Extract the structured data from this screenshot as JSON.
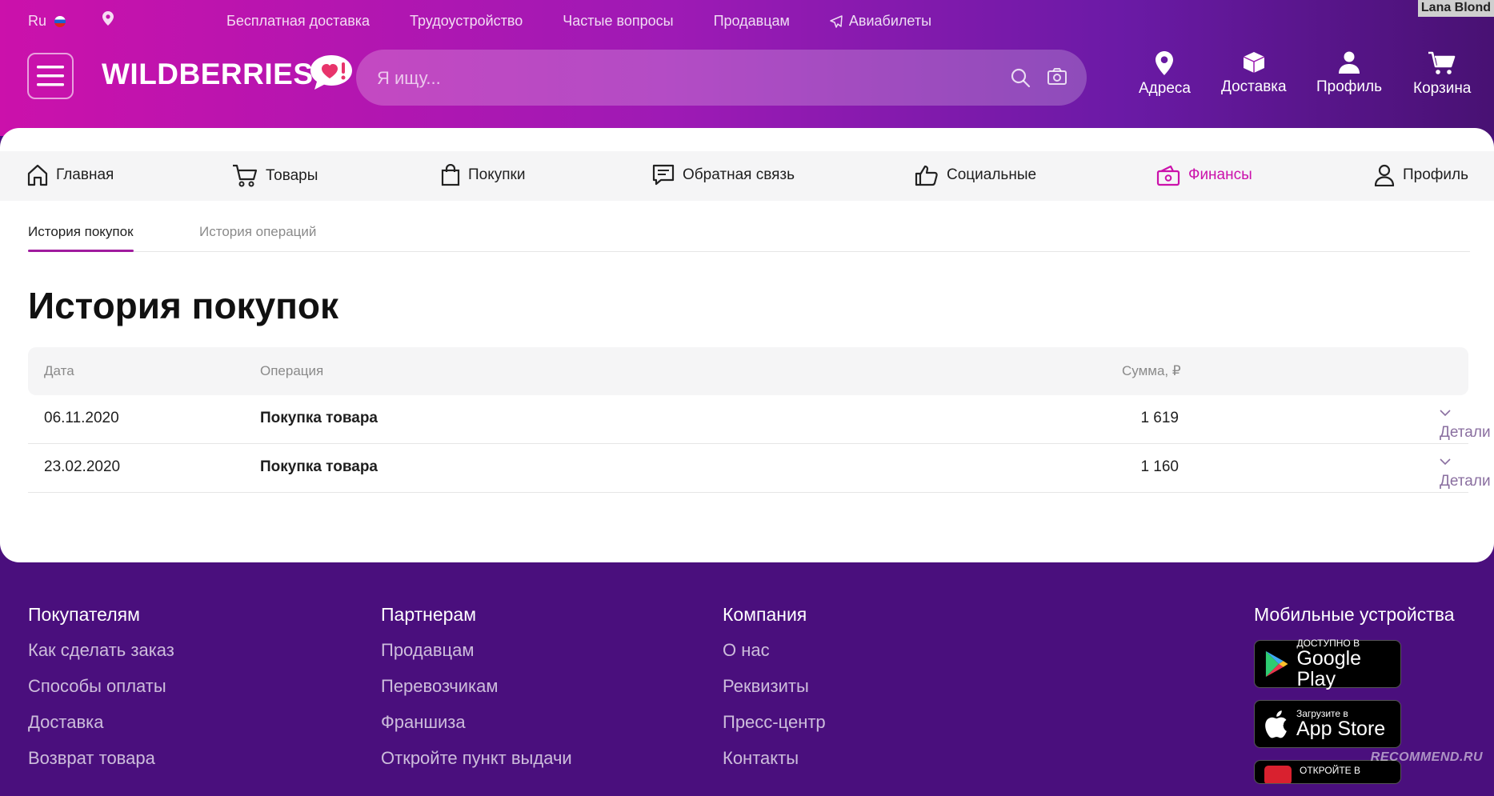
{
  "topbar": {
    "lang": "Ru",
    "links": [
      "Бесплатная доставка",
      "Трудоустройство",
      "Частые вопросы",
      "Продавцам",
      "Авиабилеты"
    ],
    "username": "Lana Blond"
  },
  "logo": {
    "text": "WILDBERRIES"
  },
  "search": {
    "placeholder": "Я ищу..."
  },
  "header_nav": [
    "Адреса",
    "Доставка",
    "Профиль",
    "Корзина"
  ],
  "main_nav": {
    "items": [
      "Главная",
      "Товары",
      "Покупки",
      "Обратная связь",
      "Социальные",
      "Финансы",
      "Профиль"
    ],
    "active": "Финансы"
  },
  "subtabs": [
    "История покупок",
    "История операций"
  ],
  "page_title": "История покупок",
  "table": {
    "headers": [
      "Дата",
      "Операция",
      "Сумма, ₽"
    ],
    "rows": [
      {
        "date": "06.11.2020",
        "operation": "Покупка товара",
        "amount": "1 619",
        "details": "Детали"
      },
      {
        "date": "23.02.2020",
        "operation": "Покупка товара",
        "amount": "1 160",
        "details": "Детали"
      }
    ]
  },
  "footer": {
    "buyers": {
      "title": "Покупателям",
      "links": [
        "Как сделать заказ",
        "Способы оплаты",
        "Доставка",
        "Возврат товара"
      ]
    },
    "partners": {
      "title": "Партнерам",
      "links": [
        "Продавцам",
        "Перевозчикам",
        "Франшиза",
        "Откройте пункт выдачи"
      ]
    },
    "company": {
      "title": "Компания",
      "links": [
        "О нас",
        "Реквизиты",
        "Пресс-центр",
        "Контакты"
      ]
    },
    "mobile": {
      "title": "Мобильные устройства",
      "google_small": "ДОСТУПНО В",
      "google_big": "Google Play",
      "apple_small": "Загрузите в",
      "apple_big": "App Store",
      "third_small": "ОТКРОЙТЕ В"
    }
  },
  "watermark": "RECOMMEND.RU",
  "colors": {
    "brand": "#cb11ab",
    "footer": "#4a0f7d",
    "details": "#8a6fa0"
  }
}
